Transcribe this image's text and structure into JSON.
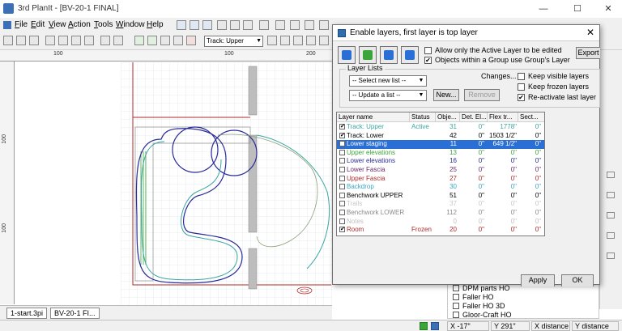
{
  "window": {
    "title": "3rd PlanIt - [BV-20-1 FINAL]",
    "controls": [
      "—",
      "☐",
      "✕"
    ]
  },
  "menu": [
    {
      "key": "F",
      "rest": "ile"
    },
    {
      "key": "E",
      "rest": "dit"
    },
    {
      "key": "V",
      "rest": "iew"
    },
    {
      "key": "A",
      "rest": "ction"
    },
    {
      "key": "T",
      "rest": "ools"
    },
    {
      "key": "W",
      "rest": "indow"
    },
    {
      "key": "H",
      "rest": "elp"
    }
  ],
  "toolbar": {
    "layer_select": "Track: Upper"
  },
  "rulers": {
    "top": [
      "100",
      "100",
      "200"
    ],
    "left": [
      "100",
      "100"
    ]
  },
  "dialog": {
    "title": "Enable layers, first layer is top layer",
    "close": "✕",
    "options": {
      "active_only": "Allow only the Active Layer to be edited",
      "group_layer": "Objects within a Group use Group's Layer",
      "keep_visible": "Keep visible layers",
      "keep_frozen": "Keep frozen layers",
      "reactivate": "Re-activate last layer"
    },
    "export_label": "Export",
    "layer_lists_label": "Layer Lists",
    "select_list": "-- Select new list --",
    "update_list": "-- Update a list --",
    "changes_label": "Changes...",
    "new_button": "New...",
    "remove_button": "Remove",
    "table": {
      "columns": [
        "Layer name",
        "Status",
        "Obje...",
        "Det. El...",
        "Flex tr...",
        "Sect..."
      ],
      "rows": [
        {
          "checked": true,
          "name": "Track: Upper",
          "status": "Active",
          "objects": "31",
          "det": "0\"",
          "flex": "1778\"",
          "sect": "0\"",
          "color": "#3aa6a0",
          "selected": false
        },
        {
          "checked": true,
          "name": "Track: Lower",
          "status": "",
          "objects": "42",
          "det": "0\"",
          "flex": "1503 1/2\"",
          "sect": "0\"",
          "color": "#000000",
          "selected": false
        },
        {
          "checked": false,
          "name": "Lower staging",
          "status": "",
          "objects": "11",
          "det": "0\"",
          "flex": "649 1/2\"",
          "sect": "0\"",
          "color": "#ffffff",
          "selected": true
        },
        {
          "checked": false,
          "name": "Upper elevations",
          "status": "",
          "objects": "13",
          "det": "0\"",
          "flex": "0\"",
          "sect": "0\"",
          "color": "#3aa63a",
          "selected": false
        },
        {
          "checked": false,
          "name": "Lower elevations",
          "status": "",
          "objects": "16",
          "det": "0\"",
          "flex": "0\"",
          "sect": "0\"",
          "color": "#2a2a9a",
          "selected": false
        },
        {
          "checked": false,
          "name": "Lower Fascia",
          "status": "",
          "objects": "25",
          "det": "0\"",
          "flex": "0\"",
          "sect": "0\"",
          "color": "#6a2a6a",
          "selected": false
        },
        {
          "checked": false,
          "name": "Upper Fascia",
          "status": "",
          "objects": "27",
          "det": "0\"",
          "flex": "0\"",
          "sect": "0\"",
          "color": "#b02a2a",
          "selected": false
        },
        {
          "checked": false,
          "name": "Backdrop",
          "status": "",
          "objects": "30",
          "det": "0\"",
          "flex": "0\"",
          "sect": "0\"",
          "color": "#3aa6c8",
          "selected": false
        },
        {
          "checked": false,
          "name": "Benchwork UPPER",
          "status": "",
          "objects": "51",
          "det": "0\"",
          "flex": "0\"",
          "sect": "0\"",
          "color": "#000000",
          "selected": false
        },
        {
          "checked": false,
          "name": "Trails",
          "status": "",
          "objects": "37",
          "det": "0\"",
          "flex": "0\"",
          "sect": "0\"",
          "color": "#c8c8c8",
          "selected": false
        },
        {
          "checked": false,
          "name": "Benchwork LOWER",
          "status": "",
          "objects": "112",
          "det": "0\"",
          "flex": "0\"",
          "sect": "0\"",
          "color": "#8a8a8a",
          "selected": false
        },
        {
          "checked": false,
          "name": "Notes",
          "status": "",
          "objects": "0",
          "det": "0\"",
          "flex": "0\"",
          "sect": "0\"",
          "color": "#c0c0c0",
          "selected": false
        },
        {
          "checked": true,
          "name": "Room",
          "status": "Frozen",
          "objects": "20",
          "det": "0\"",
          "flex": "0\"",
          "sect": "0\"",
          "color": "#b02a2a",
          "selected": false
        }
      ]
    },
    "apply_button": "Apply",
    "ok_button": "OK"
  },
  "catalog": {
    "items": [
      "DPM parts HO",
      "Faller HO",
      "Faller HO 3D",
      "Gloor-Craft HO"
    ]
  },
  "doc_tabs": [
    "1-start.3pi",
    "BV-20-1 FI..."
  ],
  "status": {
    "x": "X -17\"",
    "y": "Y 291\"",
    "xdist": "X distance",
    "ydist": "Y distance"
  },
  "colors": {
    "track_upper": "#3aa6a0",
    "track_lower": "#2a2a9a",
    "room": "#b02a2a",
    "selection": "#2a6fd6",
    "elevation_green": "#3aa63a"
  }
}
